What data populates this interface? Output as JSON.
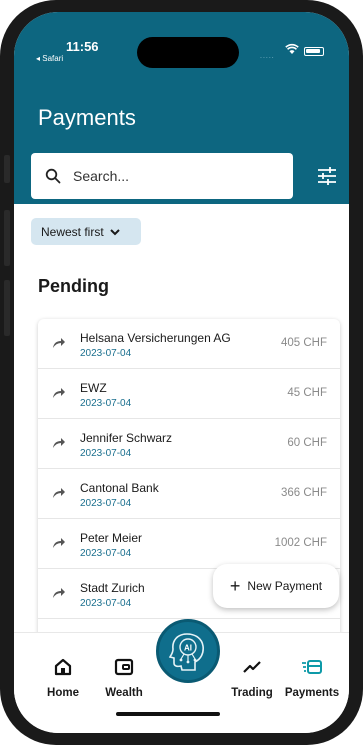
{
  "status_bar": {
    "time": "11:56",
    "back_label": "◂ Safari",
    "signal": "....."
  },
  "header": {
    "title": "Payments",
    "search_placeholder": "Search..."
  },
  "sort": {
    "label": "Newest first"
  },
  "section": {
    "title": "Pending"
  },
  "payments": [
    {
      "name": "Helsana Versicherungen AG",
      "date": "2023-07-04",
      "amount": "405 CHF"
    },
    {
      "name": "EWZ",
      "date": "2023-07-04",
      "amount": "45 CHF"
    },
    {
      "name": "Jennifer Schwarz",
      "date": "2023-07-04",
      "amount": "60 CHF"
    },
    {
      "name": "Cantonal Bank",
      "date": "2023-07-04",
      "amount": "366 CHF"
    },
    {
      "name": "Peter Meier",
      "date": "2023-07-04",
      "amount": "1002 CHF"
    },
    {
      "name": "Stadt Zurich",
      "date": "2023-07-04",
      "amount": ""
    }
  ],
  "fab": {
    "label": "New Payment"
  },
  "nav": {
    "home": "Home",
    "wealth": "Wealth",
    "ai": "AI",
    "trading": "Trading",
    "payments": "Payments"
  },
  "colors": {
    "brand": "#0d6680",
    "accent_date": "#1a6f8e",
    "chip_bg": "#d5e6f0",
    "active_nav": "#0d9aa8"
  }
}
